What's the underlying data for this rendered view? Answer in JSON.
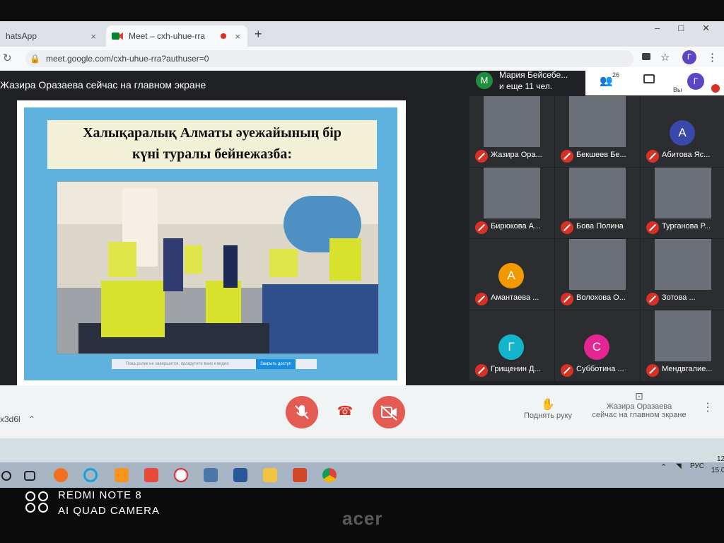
{
  "browser": {
    "tabs": [
      {
        "label": "hatsApp",
        "close": "×"
      },
      {
        "label": "Meet – cxh-uhue-rra",
        "close": "×"
      }
    ],
    "new_tab": "+",
    "window_controls": [
      "–",
      "□",
      "✕"
    ],
    "url": "meet.google.com/cxh-uhue-rra?authuser=0",
    "profile_initial": "Г"
  },
  "meet": {
    "presenting_banner": "Жазира Оразаева сейчас на главном экране",
    "header": {
      "avatar_initial": "М",
      "names_line1": "Мария Бейсебе...",
      "names_line2": "и еще 11 чел.",
      "people_count": "26",
      "you_label": "Вы",
      "you_initial": "Г"
    },
    "slide": {
      "title_line1": "Халықаралық Алматы әуежайының бір",
      "title_line2": "күні туралы бейнежазба:",
      "bar_text": "Пока ролик не завершится, прокрутите вниз к видео",
      "bar_button": "Закрыть доступ"
    },
    "tiles": [
      {
        "name": "Жазира Ора...",
        "initial": "",
        "color": "#2b2d31"
      },
      {
        "name": "Бекшеев Бе...",
        "initial": "",
        "color": "#2b2d31"
      },
      {
        "name": "Абитова Яс...",
        "initial": "А",
        "color": "#3949ab"
      },
      {
        "name": "Бирюкова А...",
        "initial": "",
        "color": "#2b2d31"
      },
      {
        "name": "Бова Полина",
        "initial": "",
        "color": "#2b2d31"
      },
      {
        "name": "Турганова Р...",
        "initial": "",
        "color": "#2b2d31"
      },
      {
        "name": "Амантаева ...",
        "initial": "А",
        "color": "#f29900"
      },
      {
        "name": "Волохова О...",
        "initial": "",
        "color": "#2b2d31"
      },
      {
        "name": "Зотова ...",
        "initial": "",
        "color": "#2b2d31"
      },
      {
        "name": "Грищенин Д...",
        "initial": "Г",
        "color": "#12b5cb"
      },
      {
        "name": "Субботина ...",
        "initial": "С",
        "color": "#e52592"
      },
      {
        "name": "Мендвгалие...",
        "initial": "",
        "color": "#2b2d31"
      }
    ],
    "controls": {
      "meeting_code": "x3d6l",
      "raise_hand": "Поднять руку",
      "presenting_line1": "Жазира Оразаева",
      "presenting_line2": "сейчас на главном экране",
      "more": "⋮"
    }
  },
  "taskbar": {
    "lang": "РУС",
    "time": "12",
    "date": "15.0"
  },
  "photo_watermark": {
    "line1": "REDMI NOTE 8",
    "line2": "AI QUAD CAMERA"
  },
  "laptop_brand": "acer"
}
